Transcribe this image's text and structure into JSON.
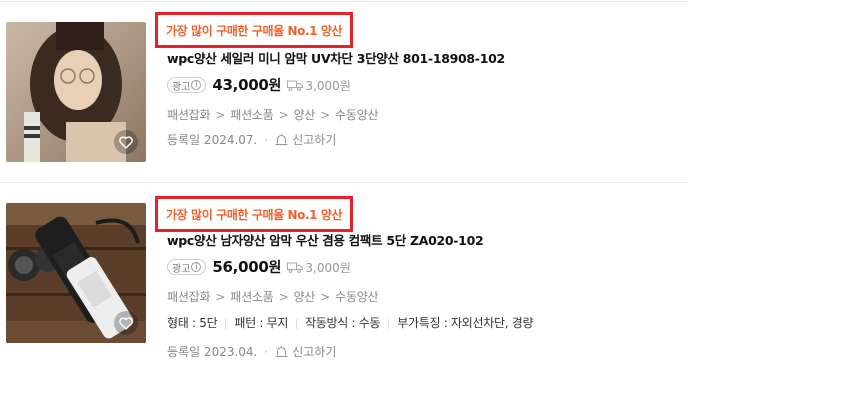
{
  "products": [
    {
      "badge": "가장 많이 구매한 구매율 No.1 양산",
      "title": "wpc양산 세일러 미니 암막 UV차단 3단양산 801-18908-102",
      "ad_label": "광고",
      "ad_info": "i",
      "price": "43,000",
      "price_unit": "원",
      "delivery_fee": "3,000원",
      "categories": [
        "패션잡화",
        "패션소품",
        "양산",
        "수동양산"
      ],
      "category_separator": ">",
      "registered": "등록일 2024.07.",
      "report_label": "신고하기"
    },
    {
      "badge": "가장 많이 구매한 구매율 No.1 양산",
      "title": "wpc양산 남자양산 암막 우산 겸용 컴팩트 5단 ZA020-102",
      "ad_label": "광고",
      "ad_info": "i",
      "price": "56,000",
      "price_unit": "원",
      "delivery_fee": "3,000원",
      "categories": [
        "패션잡화",
        "패션소품",
        "양산",
        "수동양산"
      ],
      "category_separator": ">",
      "specs": [
        "형태 : 5단",
        "패턴 : 무지",
        "작동방식 : 수동",
        "부가특징 : 자외선차단, 경량"
      ],
      "registered": "등록일 2023.04.",
      "report_label": "신고하기"
    }
  ],
  "meta_dot": "·",
  "colors": {
    "badge_border": "#e8202a",
    "badge_text": "#f0612a"
  },
  "icons": {
    "wishlist": "heart-icon",
    "delivery": "truck-icon",
    "report": "bell-icon"
  }
}
